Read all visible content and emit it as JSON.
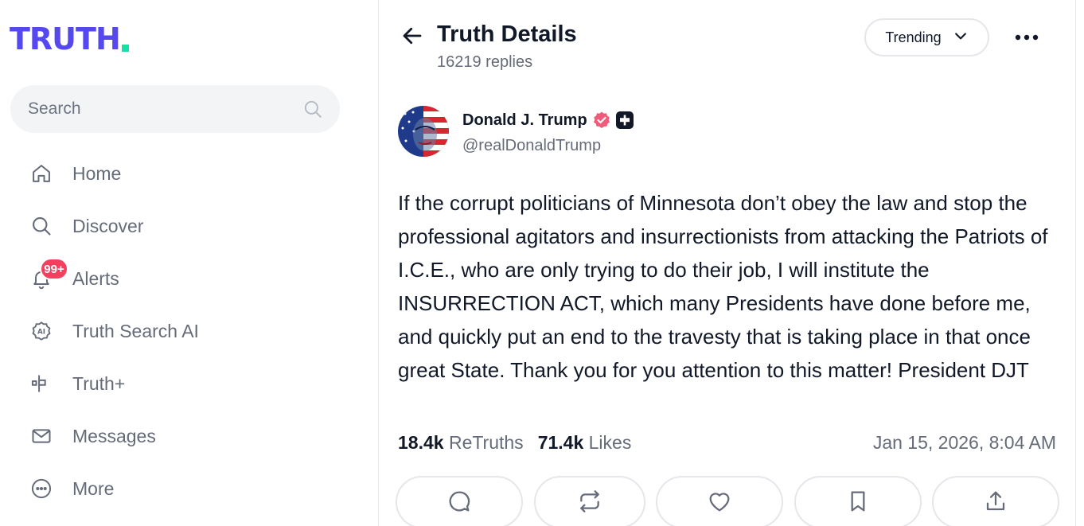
{
  "brand": {
    "logo_text": "TRUTH",
    "logo_color": "#5448ee",
    "logo_dot_color": "#17e0a5"
  },
  "search": {
    "placeholder": "Search",
    "icon": "search-icon"
  },
  "nav": {
    "items": [
      {
        "label": "Home",
        "icon": "home-icon"
      },
      {
        "label": "Discover",
        "icon": "search-icon"
      },
      {
        "label": "Alerts",
        "icon": "bell-icon",
        "badge": "99+"
      },
      {
        "label": "Truth Search AI",
        "icon": "ai-icon"
      },
      {
        "label": "Truth+",
        "icon": "truth-plus-icon"
      },
      {
        "label": "Messages",
        "icon": "mail-icon"
      },
      {
        "label": "More",
        "icon": "more-circle-icon"
      }
    ]
  },
  "header": {
    "title": "Truth Details",
    "replies": "16219 replies",
    "sort_label": "Trending"
  },
  "post": {
    "author_name": "Donald J. Trump",
    "author_handle": "@realDonaldTrump",
    "text": "If the corrupt politicians of Minnesota don’t obey the law and stop the professional agitators and insurrectionists from attacking the Patriots of I.C.E., who are only trying to do their job, I will institute the INSURRECTION ACT, which many Presidents have done before me, and quickly put an end to the travesty that is taking place in that once great State. Thank you for you attention to this matter! President DJT",
    "retruths_count": "18.4k",
    "retruths_label": "ReTruths",
    "likes_count": "71.4k",
    "likes_label": "Likes",
    "timestamp": "Jan 15, 2026, 8:04 AM"
  },
  "actions": [
    "reply-icon",
    "retruth-icon",
    "like-icon",
    "bookmark-icon",
    "share-icon"
  ],
  "colors": {
    "verified": "#f15a78",
    "badge": "#f43f5e",
    "muted_text": "#656b78"
  }
}
